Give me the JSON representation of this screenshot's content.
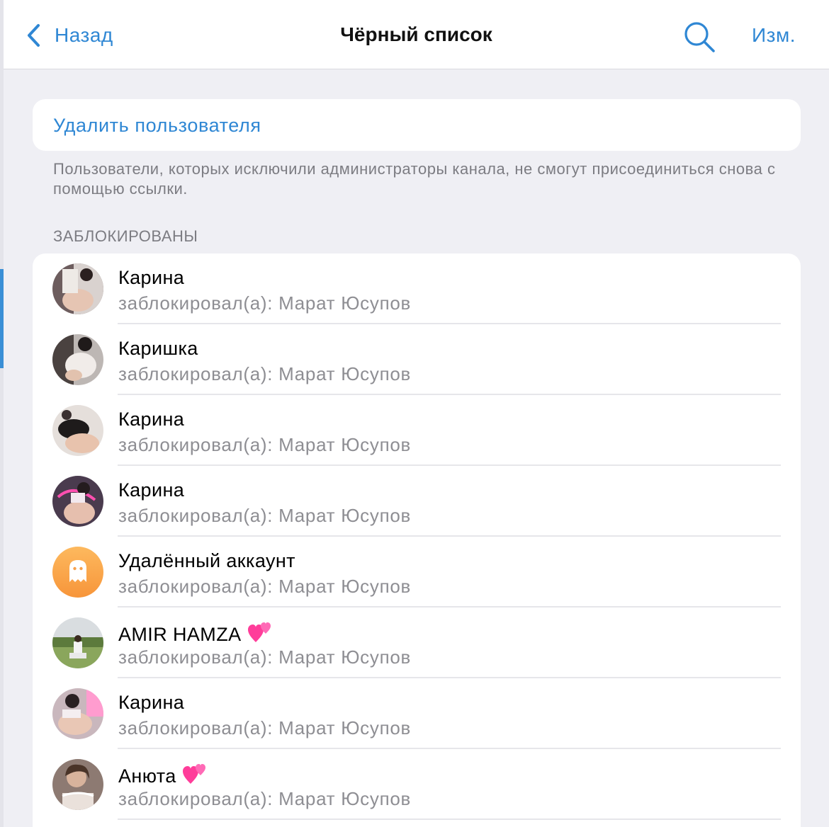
{
  "navbar": {
    "back_label": "Назад",
    "title": "Чёрный список",
    "edit_label": "Изм."
  },
  "action": {
    "remove_user_label": "Удалить пользователя"
  },
  "footer_note": "Пользователи, которых исключили администраторы канала, не смогут присоединиться снова с помощью ссылки.",
  "section_header": "ЗАБЛОКИРОВАНЫ",
  "blocked": [
    {
      "name": "Карина",
      "subtitle": "заблокировал(а): Марат Юсупов",
      "emoji": ""
    },
    {
      "name": "Каришка",
      "subtitle": "заблокировал(а): Марат Юсупов",
      "emoji": ""
    },
    {
      "name": "Карина",
      "subtitle": "заблокировал(а): Марат Юсупов",
      "emoji": ""
    },
    {
      "name": "Карина",
      "subtitle": "заблокировал(а): Марат Юсупов",
      "emoji": ""
    },
    {
      "name": "Удалённый аккаунт",
      "subtitle": "заблокировал(а): Марат Юсупов",
      "emoji": ""
    },
    {
      "name": "AMIR HAMZA",
      "subtitle": "заблокировал(а): Марат Юсупов",
      "emoji": "two-hearts"
    },
    {
      "name": "Карина",
      "subtitle": "заблокировал(а): Марат Юсупов",
      "emoji": ""
    },
    {
      "name": "Анюта",
      "subtitle": "заблокировал(а): Марат Юсупов",
      "emoji": "two-hearts"
    }
  ],
  "colors": {
    "accent": "#2f87d4",
    "background": "#efeff4",
    "secondary_text": "#8e8e93",
    "deleted_avatar": "#f9a74a"
  }
}
